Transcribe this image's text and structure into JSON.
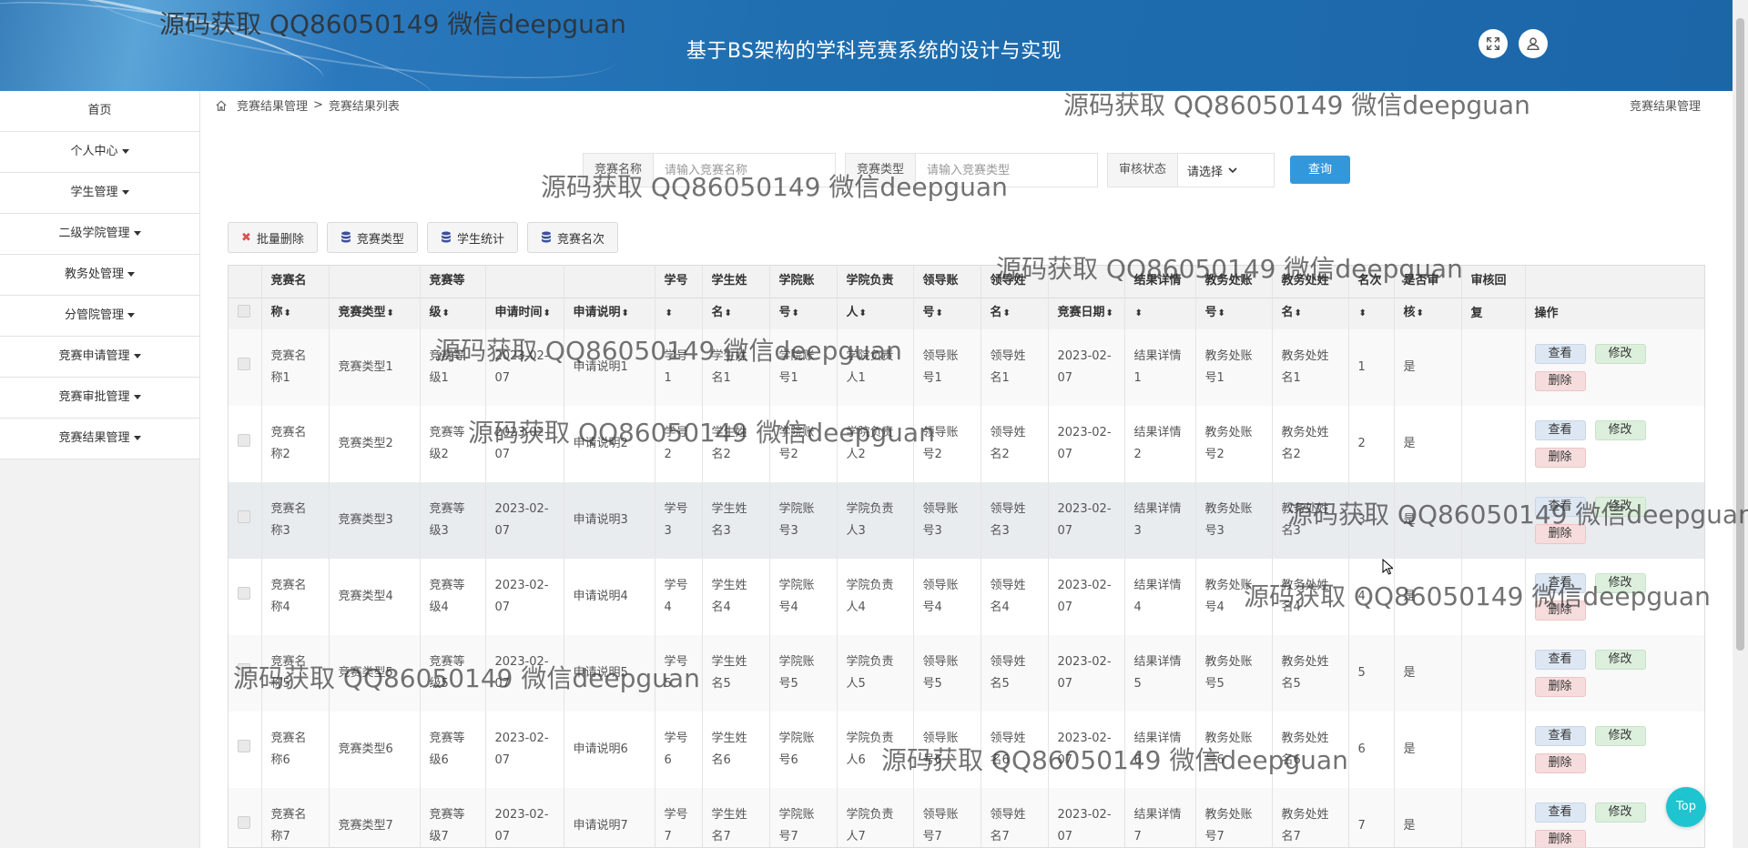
{
  "header": {
    "title": "基于BS架构的学科竞赛系统的设计与实现"
  },
  "icons": {
    "fullscreen": "fullscreen-icon",
    "user": "user-icon",
    "home": "home-icon",
    "delete": "times-icon",
    "database": "database-icon"
  },
  "sidebar": {
    "items": [
      {
        "label": "首页",
        "caret": false
      },
      {
        "label": "个人中心",
        "caret": true
      },
      {
        "label": "学生管理",
        "caret": true
      },
      {
        "label": "二级学院管理",
        "caret": true
      },
      {
        "label": "教务处管理",
        "caret": true
      },
      {
        "label": "分管院管理",
        "caret": true
      },
      {
        "label": "竞赛申请管理",
        "caret": true
      },
      {
        "label": "竞赛审批管理",
        "caret": true
      },
      {
        "label": "竞赛结果管理",
        "caret": true
      }
    ]
  },
  "breadcrumb": {
    "part1": "竞赛结果管理",
    "sep": ">",
    "part2": "竞赛结果列表",
    "right": "竞赛结果管理"
  },
  "search": {
    "name_label": "竞赛名称",
    "name_placeholder": "请输入竞赛名称",
    "type_label": "竞赛类型",
    "type_placeholder": "请输入竞赛类型",
    "status_label": "审核状态",
    "status_value": "请选择",
    "query_label": "查询"
  },
  "toolbar": {
    "batch_delete": "批量删除",
    "type": "竞赛类型",
    "stats": "学生统计",
    "rank": "竞赛名次"
  },
  "table": {
    "headers_top": [
      "竞赛名",
      "",
      "竞赛等",
      "",
      "",
      "学号",
      "学生姓",
      "学院账",
      "学院负责",
      "领导账",
      "领导姓",
      "",
      "结果详情",
      "教务处账",
      "教务处姓",
      "名次",
      "是否审",
      "审核回",
      ""
    ],
    "headers_bottom": [
      "称",
      "竞赛类型",
      "级",
      "申请时间",
      "申请说明",
      "",
      "名",
      "号",
      "人",
      "号",
      "名",
      "竞赛日期",
      "",
      "号",
      "名",
      "",
      "核",
      "复",
      "操作"
    ],
    "sortable_bottom": [
      true,
      true,
      true,
      true,
      true,
      true,
      true,
      true,
      true,
      true,
      true,
      true,
      true,
      true,
      true,
      true,
      true,
      false,
      false
    ],
    "rows": [
      {
        "c": [
          [
            "竞赛名",
            "称1"
          ],
          [
            "竞赛类型1"
          ],
          [
            "竞赛等",
            "级1"
          ],
          [
            "2023-02-",
            "07"
          ],
          [
            "申请说明1"
          ],
          [
            "学号",
            "1"
          ],
          [
            "学生姓",
            "名1"
          ],
          [
            "学院账",
            "号1"
          ],
          [
            "学院负责",
            "人1"
          ],
          [
            "领导账",
            "号1"
          ],
          [
            "领导姓",
            "名1"
          ],
          [
            "2023-02-",
            "07"
          ],
          [
            "结果详情",
            "1"
          ],
          [
            "教务处账",
            "号1"
          ],
          [
            "教务处姓",
            "名1"
          ],
          [
            "1"
          ],
          [
            "是"
          ],
          [
            ""
          ]
        ]
      },
      {
        "c": [
          [
            "竞赛名",
            "称2"
          ],
          [
            "竞赛类型2"
          ],
          [
            "竞赛等",
            "级2"
          ],
          [
            "2023-02-",
            "07"
          ],
          [
            "申请说明2"
          ],
          [
            "学号",
            "2"
          ],
          [
            "学生姓",
            "名2"
          ],
          [
            "学院账",
            "号2"
          ],
          [
            "学院负责",
            "人2"
          ],
          [
            "领导账",
            "号2"
          ],
          [
            "领导姓",
            "名2"
          ],
          [
            "2023-02-",
            "07"
          ],
          [
            "结果详情",
            "2"
          ],
          [
            "教务处账",
            "号2"
          ],
          [
            "教务处姓",
            "名2"
          ],
          [
            "2"
          ],
          [
            "是"
          ],
          [
            ""
          ]
        ]
      },
      {
        "c": [
          [
            "竞赛名",
            "称3"
          ],
          [
            "竞赛类型3"
          ],
          [
            "竞赛等",
            "级3"
          ],
          [
            "2023-02-",
            "07"
          ],
          [
            "申请说明3"
          ],
          [
            "学号",
            "3"
          ],
          [
            "学生姓",
            "名3"
          ],
          [
            "学院账",
            "号3"
          ],
          [
            "学院负责",
            "人3"
          ],
          [
            "领导账",
            "号3"
          ],
          [
            "领导姓",
            "名3"
          ],
          [
            "2023-02-",
            "07"
          ],
          [
            "结果详情",
            "3"
          ],
          [
            "教务处账",
            "号3"
          ],
          [
            "教务处姓",
            "名3"
          ],
          [
            "3"
          ],
          [
            "是"
          ],
          [
            ""
          ]
        ]
      },
      {
        "c": [
          [
            "竞赛名",
            "称4"
          ],
          [
            "竞赛类型4"
          ],
          [
            "竞赛等",
            "级4"
          ],
          [
            "2023-02-",
            "07"
          ],
          [
            "申请说明4"
          ],
          [
            "学号",
            "4"
          ],
          [
            "学生姓",
            "名4"
          ],
          [
            "学院账",
            "号4"
          ],
          [
            "学院负责",
            "人4"
          ],
          [
            "领导账",
            "号4"
          ],
          [
            "领导姓",
            "名4"
          ],
          [
            "2023-02-",
            "07"
          ],
          [
            "结果详情",
            "4"
          ],
          [
            "教务处账",
            "号4"
          ],
          [
            "教务处姓",
            "名4"
          ],
          [
            "4"
          ],
          [
            "是"
          ],
          [
            ""
          ]
        ]
      },
      {
        "c": [
          [
            "竞赛名",
            "称5"
          ],
          [
            "竞赛类型5"
          ],
          [
            "竞赛等",
            "级5"
          ],
          [
            "2023-02-",
            "07"
          ],
          [
            "申请说明5"
          ],
          [
            "学号",
            "5"
          ],
          [
            "学生姓",
            "名5"
          ],
          [
            "学院账",
            "号5"
          ],
          [
            "学院负责",
            "人5"
          ],
          [
            "领导账",
            "号5"
          ],
          [
            "领导姓",
            "名5"
          ],
          [
            "2023-02-",
            "07"
          ],
          [
            "结果详情",
            "5"
          ],
          [
            "教务处账",
            "号5"
          ],
          [
            "教务处姓",
            "名5"
          ],
          [
            "5"
          ],
          [
            "是"
          ],
          [
            ""
          ]
        ]
      },
      {
        "c": [
          [
            "竞赛名",
            "称6"
          ],
          [
            "竞赛类型6"
          ],
          [
            "竞赛等",
            "级6"
          ],
          [
            "2023-02-",
            "07"
          ],
          [
            "申请说明6"
          ],
          [
            "学号",
            "6"
          ],
          [
            "学生姓",
            "名6"
          ],
          [
            "学院账",
            "号6"
          ],
          [
            "学院负责",
            "人6"
          ],
          [
            "领导账",
            "号6"
          ],
          [
            "领导姓",
            "名6"
          ],
          [
            "2023-02-",
            "07"
          ],
          [
            "结果详情",
            "6"
          ],
          [
            "教务处账",
            "号6"
          ],
          [
            "教务处姓",
            "名6"
          ],
          [
            "6"
          ],
          [
            "是"
          ],
          [
            ""
          ]
        ]
      },
      {
        "c": [
          [
            "竞赛名",
            "称7"
          ],
          [
            "竞赛类型7"
          ],
          [
            "竞赛等",
            "级7"
          ],
          [
            "2023-02-",
            "07"
          ],
          [
            "申请说明7"
          ],
          [
            "学号",
            "7"
          ],
          [
            "学生姓",
            "名7"
          ],
          [
            "学院账",
            "号7"
          ],
          [
            "学院负责",
            "人7"
          ],
          [
            "领导账",
            "号7"
          ],
          [
            "领导姓",
            "名7"
          ],
          [
            "2023-02-",
            "07"
          ],
          [
            "结果详情",
            "7"
          ],
          [
            "教务处账",
            "号7"
          ],
          [
            "教务处姓",
            "名7"
          ],
          [
            "7"
          ],
          [
            "是"
          ],
          [
            ""
          ]
        ]
      }
    ],
    "actions": {
      "view": "查看",
      "edit": "修改",
      "delete": "删除"
    },
    "highlight_row": 2
  },
  "top_button": "Top",
  "watermark": "源码获取 QQ86050149 微信deepguan"
}
